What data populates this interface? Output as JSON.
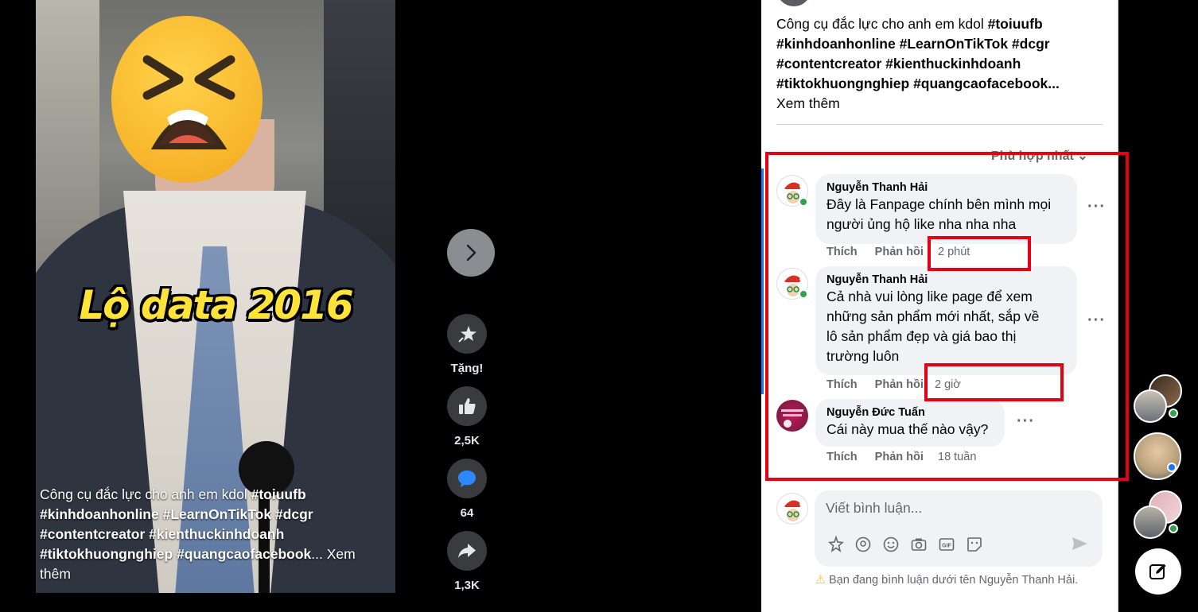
{
  "video": {
    "overlay_title": "Lộ data 2016",
    "caption_plain": "Công cụ đắc lực cho anh em kdol ",
    "caption_tags": "#toiuufb #kinhdoanhonline #LearnOnTikTok #dcgr #contentcreator #kienthuckinhdoanh #tiktokhuongnghiep #quangcaofacebook",
    "caption_more": "... Xem thêm"
  },
  "actions": {
    "gift_label": "Tặng!",
    "like_count": "2,5K",
    "comment_count": "64",
    "share_count": "1,3K"
  },
  "post": {
    "text_plain": "Công cụ đắc lực cho anh em kdol ",
    "line1_tag": "#toiuufb",
    "line2": "#kinhdoanhonline #LearnOnTikTok #dcgr",
    "line3": "#contentcreator #kienthuckinhdoanh",
    "line4": "#tiktokhuongnghiep #quangcaofacebook...",
    "see_more": "Xem thêm"
  },
  "sort_label": "Phù hợp nhất",
  "comments": [
    {
      "author": "Nguyễn Thanh Hải",
      "lines": [
        "Đây là Fanpage chính bên mình mọi",
        "người ủng hộ like nha nha nha"
      ],
      "like": "Thích",
      "reply": "Phản hồi",
      "time": "2 phút"
    },
    {
      "author": "Nguyễn Thanh Hải",
      "lines": [
        "Cả nhà vui lòng like page để xem",
        "những sản phẩm mới nhất, sắp về",
        "lô sản phẩm đẹp và giá bao thị",
        "trường luôn"
      ],
      "like": "Thích",
      "reply": "Phản hồi",
      "time": "2 giờ"
    },
    {
      "author": "Nguyễn Đức Tuấn",
      "lines": [
        "Cái này mua thế nào vậy?"
      ],
      "like": "Thích",
      "reply": "Phản hồi",
      "time": "18 tuần"
    }
  ],
  "composer": {
    "placeholder": "Viết bình luận...",
    "notice": "Bạn đang bình luận dưới tên Nguyễn Thanh Hải."
  },
  "colors": {
    "highlight_box": "#e60012",
    "overlay_text": "#ffe338",
    "online": "#31a24c"
  }
}
